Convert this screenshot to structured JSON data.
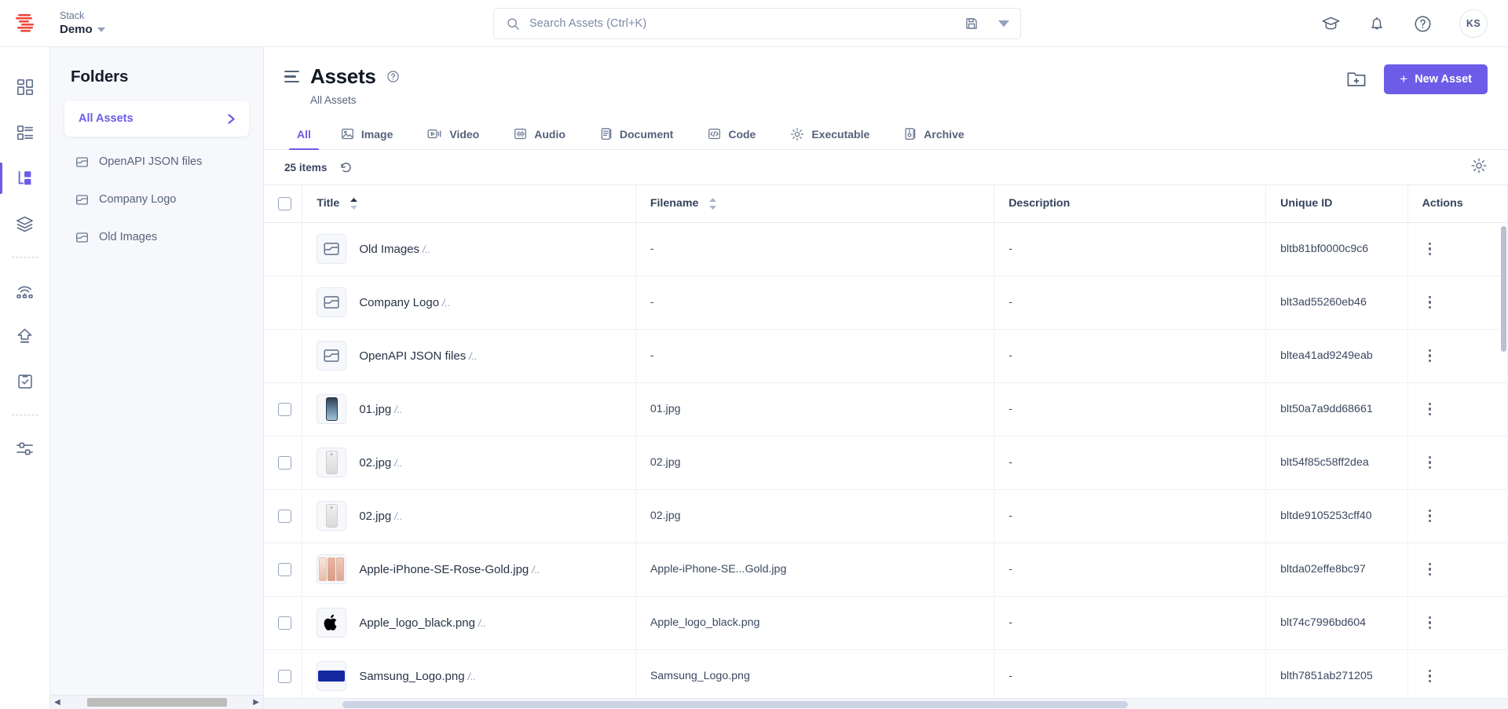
{
  "topbar": {
    "stack_label": "Stack",
    "stack_name": "Demo",
    "search_placeholder": "Search Assets (Ctrl+K)",
    "avatar_initials": "KS",
    "icons": {
      "logo": "contentstack-logo",
      "save_search": "save-icon",
      "search_dropdown": "chevron-down-icon",
      "academy": "graduation-cap-icon",
      "notifications": "bell-icon",
      "help": "help-circle-icon"
    }
  },
  "rail": {
    "items": [
      {
        "name": "dashboard",
        "icon": "dashboard-grid-icon",
        "active": false
      },
      {
        "name": "entries",
        "icon": "content-list-icon",
        "active": false
      },
      {
        "name": "assets",
        "icon": "assets-icon",
        "active": true
      },
      {
        "name": "stacks",
        "icon": "layers-icon",
        "active": false
      },
      {
        "name": "live-preview",
        "icon": "broadcast-icon",
        "active": false
      },
      {
        "name": "releases",
        "icon": "upload-arrow-icon",
        "active": false
      },
      {
        "name": "tasks",
        "icon": "clipboard-check-icon",
        "active": false
      },
      {
        "name": "settings",
        "icon": "sliders-icon",
        "active": false
      }
    ]
  },
  "folders": {
    "title": "Folders",
    "all_assets": "All Assets",
    "items": [
      {
        "label": "OpenAPI JSON files"
      },
      {
        "label": "Company Logo"
      },
      {
        "label": "Old Images"
      }
    ]
  },
  "page": {
    "title": "Assets",
    "breadcrumb": "All Assets",
    "new_asset_label": "New Asset",
    "new_asset_plus": "+",
    "new_folder_icon": "new-folder-icon",
    "help_icon": "help-circle-icon",
    "menu_icon": "hamburger-icon",
    "accent_color": "#6c5ce7"
  },
  "tabs": [
    {
      "label": "All",
      "icon": "",
      "active": true
    },
    {
      "label": "Image",
      "icon": "image-icon",
      "active": false
    },
    {
      "label": "Video",
      "icon": "video-icon",
      "active": false
    },
    {
      "label": "Audio",
      "icon": "audio-icon",
      "active": false
    },
    {
      "label": "Document",
      "icon": "document-icon",
      "active": false
    },
    {
      "label": "Code",
      "icon": "code-icon",
      "active": false
    },
    {
      "label": "Executable",
      "icon": "gear-icon",
      "active": false
    },
    {
      "label": "Archive",
      "icon": "archive-icon",
      "active": false
    }
  ],
  "toolbar": {
    "items_count": "25 items",
    "refresh_icon": "refresh-icon",
    "settings_icon": "gear-icon"
  },
  "table": {
    "columns": [
      {
        "label": "Title",
        "sort": "asc"
      },
      {
        "label": "Filename",
        "sort": "none"
      },
      {
        "label": "Description",
        "sort": null
      },
      {
        "label": "Unique ID",
        "sort": null
      },
      {
        "label": "Actions",
        "sort": null
      }
    ],
    "rows": [
      {
        "type": "folder",
        "thumb": "folder-icon",
        "selectable": false,
        "title": "Old Images",
        "path": "/..",
        "filename": "-",
        "description": "-",
        "uid": "bltb81bf0000c9c6"
      },
      {
        "type": "folder",
        "thumb": "folder-icon",
        "selectable": false,
        "title": "Company Logo",
        "path": "/..",
        "filename": "-",
        "description": "-",
        "uid": "blt3ad55260eb46"
      },
      {
        "type": "folder",
        "thumb": "folder-icon",
        "selectable": false,
        "title": "OpenAPI JSON files",
        "path": "/..",
        "filename": "-",
        "description": "-",
        "uid": "bltea41ad9249eab"
      },
      {
        "type": "file",
        "thumb": "phone-dark-thumb",
        "selectable": true,
        "title": "01.jpg",
        "path": "/..",
        "filename": "01.jpg",
        "description": "-",
        "uid": "blt50a7a9dd68661"
      },
      {
        "type": "file",
        "thumb": "phone-light-thumb",
        "selectable": true,
        "title": "02.jpg",
        "path": "/..",
        "filename": "02.jpg",
        "description": "-",
        "uid": "blt54f85c58ff2dea"
      },
      {
        "type": "file",
        "thumb": "phone-light-thumb",
        "selectable": true,
        "title": "02.jpg",
        "path": "/..",
        "filename": "02.jpg",
        "description": "-",
        "uid": "bltde9105253cff40"
      },
      {
        "type": "file",
        "thumb": "iphone-rose-thumb",
        "selectable": true,
        "title": "Apple-iPhone-SE-Rose-Gold.jpg",
        "path": "/..",
        "filename": "Apple-iPhone-SE...Gold.jpg",
        "description": "-",
        "uid": "bltda02effe8bc97"
      },
      {
        "type": "file",
        "thumb": "apple-logo-thumb",
        "selectable": true,
        "title": "Apple_logo_black.png",
        "path": "/..",
        "filename": "Apple_logo_black.png",
        "description": "-",
        "uid": "blt74c7996bd604"
      },
      {
        "type": "file",
        "thumb": "samsung-logo-thumb",
        "selectable": true,
        "title": "Samsung_Logo.png",
        "path": "/..",
        "filename": "Samsung_Logo.png",
        "description": "-",
        "uid": "blth7851ab271205"
      }
    ]
  }
}
